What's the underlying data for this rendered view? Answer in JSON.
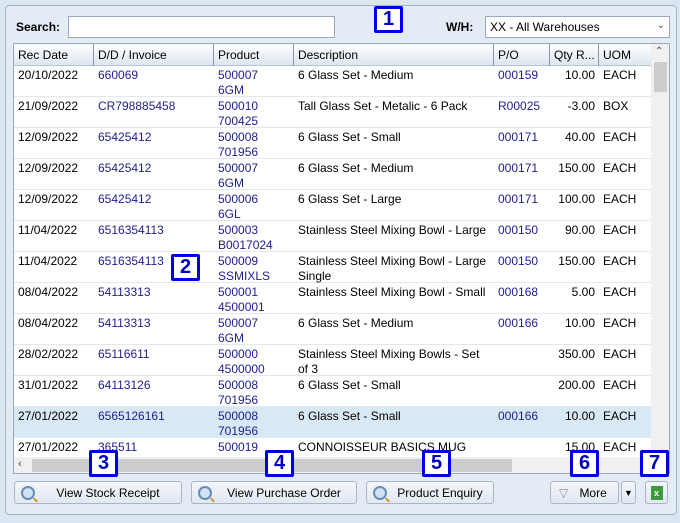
{
  "search": {
    "label": "Search:",
    "value": ""
  },
  "warehouse": {
    "label": "W/H:",
    "selected": "XX - All Warehouses"
  },
  "table": {
    "columns": [
      "Rec Date",
      "D/D / Invoice",
      "Product",
      "Description",
      "P/O",
      "Qty R...",
      "UOM"
    ],
    "rows": [
      {
        "date": "20/10/2022",
        "invoice": "660069",
        "product": "500007",
        "product2": "6GM",
        "desc": "6 Glass Set - Medium",
        "desc2": "",
        "po": "000159",
        "qty": "10.00",
        "uom": "EACH"
      },
      {
        "date": "21/09/2022",
        "invoice": "CR798885458",
        "product": "500010",
        "product2": "700425",
        "desc": "Tall Glass Set - Metalic - 6 Pack",
        "desc2": "",
        "po": "R00025",
        "qty": "-3.00",
        "uom": "BOX"
      },
      {
        "date": "12/09/2022",
        "invoice": "65425412",
        "product": "500008",
        "product2": "701956",
        "desc": "6 Glass Set - Small",
        "desc2": "",
        "po": "000171",
        "qty": "40.00",
        "uom": "EACH"
      },
      {
        "date": "12/09/2022",
        "invoice": "65425412",
        "product": "500007",
        "product2": "6GM",
        "desc": "6 Glass Set - Medium",
        "desc2": "",
        "po": "000171",
        "qty": "150.00",
        "uom": "EACH"
      },
      {
        "date": "12/09/2022",
        "invoice": "65425412",
        "product": "500006",
        "product2": "6GL",
        "desc": "6 Glass Set - Large",
        "desc2": "",
        "po": "000171",
        "qty": "100.00",
        "uom": "EACH"
      },
      {
        "date": "11/04/2022",
        "invoice": "6516354113",
        "product": "500003",
        "product2": "B0017024",
        "desc": "Stainless Steel Mixing Bowl - Large",
        "desc2": "",
        "po": "000150",
        "qty": "90.00",
        "uom": "EACH"
      },
      {
        "date": "11/04/2022",
        "invoice": "6516354113",
        "product": "500009",
        "product2": "SSMIXLS",
        "desc": "Stainless Steel Mixing Bowl - Large",
        "desc2": "Single",
        "po": "000150",
        "qty": "150.00",
        "uom": "EACH"
      },
      {
        "date": "08/04/2022",
        "invoice": "54113313",
        "product": "500001",
        "product2": "4500001",
        "desc": "Stainless Steel Mixing Bowl - Small",
        "desc2": "",
        "po": "000168",
        "qty": "5.00",
        "uom": "EACH"
      },
      {
        "date": "08/04/2022",
        "invoice": "54113313",
        "product": "500007",
        "product2": "6GM",
        "desc": "6 Glass Set - Medium",
        "desc2": "",
        "po": "000166",
        "qty": "10.00",
        "uom": "EACH"
      },
      {
        "date": "28/02/2022",
        "invoice": "65116611",
        "product": "500000",
        "product2": "4500000",
        "desc": "Stainless Steel Mixing Bowls - Set",
        "desc2": "of 3",
        "po": "",
        "qty": "350.00",
        "uom": "EACH"
      },
      {
        "date": "31/01/2022",
        "invoice": "64113126",
        "product": "500008",
        "product2": "701956",
        "desc": "6 Glass Set - Small",
        "desc2": "",
        "po": "",
        "qty": "200.00",
        "uom": "EACH"
      },
      {
        "date": "27/01/2022",
        "invoice": "6565126161",
        "product": "500008",
        "product2": "701956",
        "desc": "6 Glass Set - Small",
        "desc2": "",
        "po": "000166",
        "qty": "10.00",
        "uom": "EACH",
        "selected": true
      },
      {
        "date": "27/01/2022",
        "invoice": "365511",
        "product": "500019",
        "product2": "",
        "desc": "CONNOISSEUR BASICS MUG",
        "desc2": "",
        "po": "",
        "qty": "15.00",
        "uom": "EACH"
      }
    ]
  },
  "buttons": {
    "view_stock_receipt": "View Stock Receipt",
    "view_purchase_order": "View Purchase Order",
    "product_enquiry": "Product Enquiry",
    "more": "More"
  },
  "badges": [
    "1",
    "2",
    "3",
    "4",
    "5",
    "6",
    "7"
  ],
  "colors": {
    "link": "#1e1e8c",
    "selected_row": "#d9e8f5",
    "badge": "#0000e0"
  }
}
